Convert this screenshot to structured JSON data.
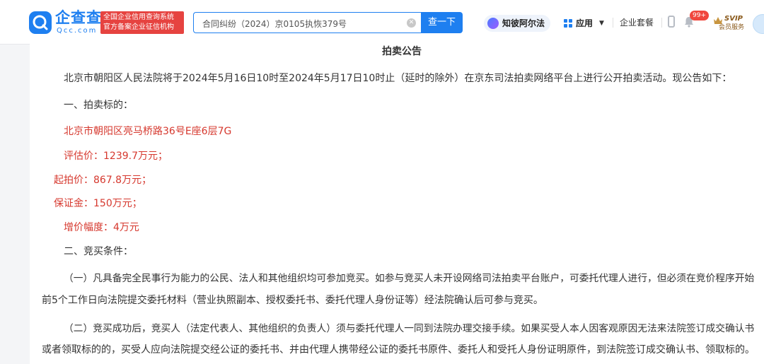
{
  "header": {
    "logo": {
      "name": "企查查",
      "domain": "Qcc.com",
      "badge_line1": "全国企业信用查询系统",
      "badge_line2": "官方备案企业征信机构"
    },
    "search": {
      "value": "合同纠纷（2024）京0105执恢379号",
      "button_label": "查一下"
    },
    "nav": {
      "zhibi_label": "知彼阿尔法",
      "apps_label": "应用",
      "package_label": "企业套餐",
      "notifications_count": "99+",
      "svip_label": "SVIP",
      "svip_sub": "会员服务"
    },
    "colors": {
      "brand": "#1e7ff0",
      "badge": "#e64340",
      "highlight_text": "#d6382e"
    }
  },
  "document": {
    "title": "拍卖公告",
    "intro": "北京市朝阳区人民法院将于2024年5月16日10时至2024年5月17日10时止（延时的除外）在京东司法拍卖网络平台上进行公开拍卖活动。现公告如下：",
    "section1": "一、拍卖标的：",
    "address": "北京市朝阳区亮马桥路36号E座6层7G",
    "appraisal": "评估价：1239.7万元；",
    "starting_price": "起拍价：867.8万元；",
    "deposit": "保证金：150万元；",
    "increment": "增价幅度：4万元",
    "section2": "二、竞买条件：",
    "cond1_line1": "（一）凡具备完全民事行为能力的公民、法人和其他组织均可参加竞买。如参与竞买人未开设网络司法拍卖平台账户，可委托代理人进行，但必须在竞价程序开始",
    "cond1_line2": "前5个工作日向法院提交委托材料（营业执照副本、授权委托书、委托代理人身份证等）经法院确认后可参与竞买。",
    "cond2_line1": "（二）竞买成功后，竞买人（法定代表人、其他组织的负责人）须与委托代理人一同到法院办理交接手续。如果买受人本人因客观原因无法来法院签订成交确认书",
    "cond2_line2": "或者领取标的的，买受人应向法院提交经公证的委托书、并由代理人携带经公证的委托书原件、委托人和受托人身份证明原件，到法院签订成交确认书、领取标的。"
  }
}
